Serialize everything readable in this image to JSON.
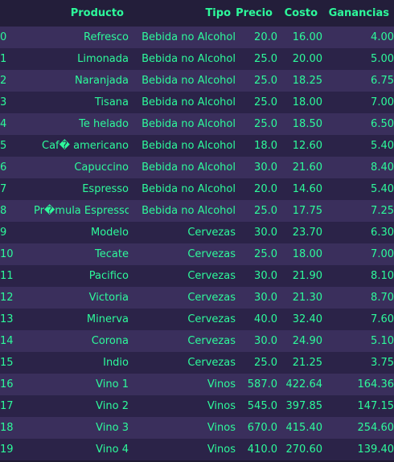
{
  "table": {
    "columns": [
      "",
      "Producto",
      "Tipo",
      "Precio",
      "Costo",
      "Ganancias"
    ],
    "rows": [
      [
        "0",
        "Refresco",
        "Bebida no Alcohol",
        "20.0",
        "16.00",
        "4.00"
      ],
      [
        "1",
        "Limonada",
        "Bebida no Alcohol",
        "25.0",
        "20.00",
        "5.00"
      ],
      [
        "2",
        "Naranjada",
        "Bebida no Alcohol",
        "25.0",
        "18.25",
        "6.75"
      ],
      [
        "3",
        "Tisana",
        "Bebida no Alcohol",
        "25.0",
        "18.00",
        "7.00"
      ],
      [
        "4",
        "Te helado",
        "Bebida no Alcohol",
        "25.0",
        "18.50",
        "6.50"
      ],
      [
        "5",
        "Caf� americano",
        "Bebida no Alcohol",
        "18.0",
        "12.60",
        "5.40"
      ],
      [
        "6",
        "Capuccino",
        "Bebida no Alcohol",
        "30.0",
        "21.60",
        "8.40"
      ],
      [
        "7",
        "Espresso",
        "Bebida no Alcohol",
        "20.0",
        "14.60",
        "5.40"
      ],
      [
        "8",
        "Pr�mula Espresso",
        "Bebida no Alcohol",
        "25.0",
        "17.75",
        "7.25"
      ],
      [
        "9",
        "Modelo",
        "Cervezas",
        "30.0",
        "23.70",
        "6.30"
      ],
      [
        "10",
        "Tecate",
        "Cervezas",
        "25.0",
        "18.00",
        "7.00"
      ],
      [
        "11",
        "Pacifico",
        "Cervezas",
        "30.0",
        "21.90",
        "8.10"
      ],
      [
        "12",
        "Victoria",
        "Cervezas",
        "30.0",
        "21.30",
        "8.70"
      ],
      [
        "13",
        "Minerva",
        "Cervezas",
        "40.0",
        "32.40",
        "7.60"
      ],
      [
        "14",
        "Corona",
        "Cervezas",
        "30.0",
        "24.90",
        "5.10"
      ],
      [
        "15",
        "Indio",
        "Cervezas",
        "25.0",
        "21.25",
        "3.75"
      ],
      [
        "16",
        "Vino 1",
        "Vinos",
        "587.0",
        "422.64",
        "164.36"
      ],
      [
        "17",
        "Vino 2",
        "Vinos",
        "545.0",
        "397.85",
        "147.15"
      ],
      [
        "18",
        "Vino 3",
        "Vinos",
        "670.0",
        "415.40",
        "254.60"
      ],
      [
        "19",
        "Vino 4",
        "Vinos",
        "410.0",
        "270.60",
        "139.40"
      ]
    ]
  },
  "colors": {
    "text": "#2dfa9b",
    "background": "#1f1a33",
    "row_odd": "#3a2f5c",
    "row_even": "#2b2348"
  }
}
